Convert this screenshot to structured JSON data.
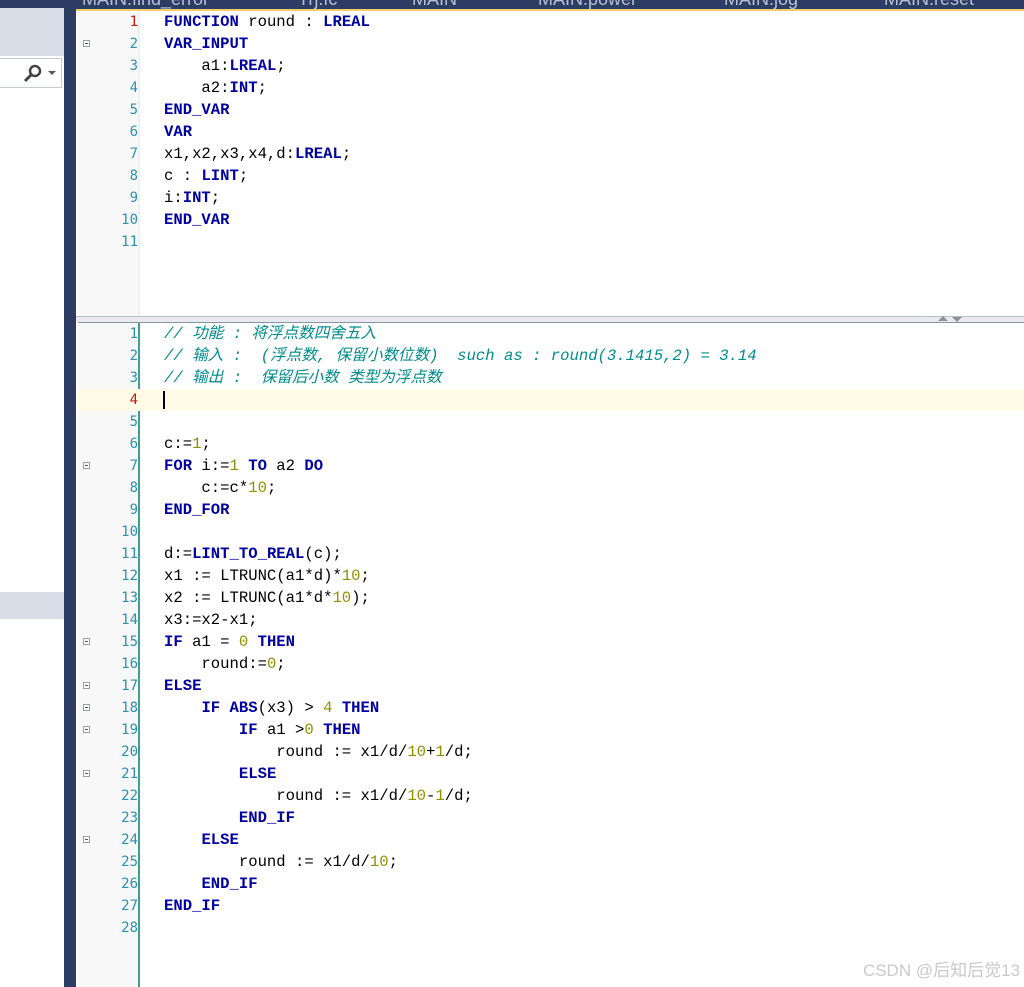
{
  "tabs": [
    "MAIN.find_error",
    "Trj.fc",
    "MAIN",
    "MAIN.power",
    "MAIN.jog",
    "MAIN.reset"
  ],
  "icons": [
    "pin-icon",
    "close-icon",
    "search-icon",
    "dropdown-arrow-icon"
  ],
  "declaration": {
    "current_line": 1,
    "lines": [
      {
        "n": "1",
        "code": "<span class='k'>FUNCTION</span> round : <span class='k'>LREAL</span>"
      },
      {
        "n": "2",
        "fold": true,
        "code": "<span class='k'>VAR_INPUT</span>"
      },
      {
        "n": "3",
        "code": "    a1:<span class='k'>LREAL</span>;"
      },
      {
        "n": "4",
        "code": "    a2:<span class='k'>INT</span>;"
      },
      {
        "n": "5",
        "code": "<span class='k'>END_VAR</span>"
      },
      {
        "n": "6",
        "code": "<span class='k'>VAR</span>"
      },
      {
        "n": "7",
        "code": "x1,x2,x3,x4,d:<span class='k'>LREAL</span>;"
      },
      {
        "n": "8",
        "code": "c : <span class='k'>LINT</span>;"
      },
      {
        "n": "9",
        "code": "i:<span class='k'>INT</span>;"
      },
      {
        "n": "10",
        "code": "<span class='k'>END_VAR</span>"
      },
      {
        "n": "11",
        "code": ""
      }
    ]
  },
  "implementation": {
    "current_line": 4,
    "lines": [
      {
        "n": "1",
        "code": "<span class='c'>// 功能 : 将浮点数四舍五入</span>"
      },
      {
        "n": "2",
        "code": "<span class='c'>// 输入 :  (浮点数, 保留小数位数)  such as : round(3.1415,2) = 3.14</span>"
      },
      {
        "n": "3",
        "code": "<span class='c'>// 输出 :  保留后小数 类型为浮点数</span>"
      },
      {
        "n": "4",
        "code": "",
        "cur": true
      },
      {
        "n": "5",
        "code": ""
      },
      {
        "n": "6",
        "code": "c:=<span class='n'>1</span>;"
      },
      {
        "n": "7",
        "fold": true,
        "code": "<span class='k'>FOR</span> i:=<span class='n'>1</span> <span class='k'>TO</span> a2 <span class='k'>DO</span>"
      },
      {
        "n": "8",
        "code": "    c:=c*<span class='n'>10</span>;"
      },
      {
        "n": "9",
        "code": "<span class='k'>END_FOR</span>"
      },
      {
        "n": "10",
        "code": ""
      },
      {
        "n": "11",
        "code": "d:=<span class='k'>LINT_TO_REAL</span>(c);"
      },
      {
        "n": "12",
        "code": "x1 := LTRUNC(a1*d)*<span class='n'>10</span>;"
      },
      {
        "n": "13",
        "code": "x2 := LTRUNC(a1*d*<span class='n'>10</span>);"
      },
      {
        "n": "14",
        "code": "x3:=x2-x1;"
      },
      {
        "n": "15",
        "fold": true,
        "code": "<span class='k'>IF</span> a1 = <span class='n'>0</span> <span class='k'>THEN</span>"
      },
      {
        "n": "16",
        "code": "    round:=<span class='n'>0</span>;"
      },
      {
        "n": "17",
        "fold": true,
        "code": "<span class='k'>ELSE</span>"
      },
      {
        "n": "18",
        "fold": true,
        "code": "    <span class='k'>IF</span> <span class='k'>ABS</span>(x3) &gt; <span class='n'>4</span> <span class='k'>THEN</span>"
      },
      {
        "n": "19",
        "fold": true,
        "code": "        <span class='k'>IF</span> a1 &gt;<span class='n'>0</span> <span class='k'>THEN</span>"
      },
      {
        "n": "20",
        "code": "            round := x1/d/<span class='n'>10</span>+<span class='n'>1</span>/d;"
      },
      {
        "n": "21",
        "fold": true,
        "code": "        <span class='k'>ELSE</span>"
      },
      {
        "n": "22",
        "code": "            round := x1/d/<span class='n'>10</span>-<span class='n'>1</span>/d;"
      },
      {
        "n": "23",
        "code": "        <span class='k'>END_IF</span>"
      },
      {
        "n": "24",
        "fold": true,
        "code": "    <span class='k'>ELSE</span>"
      },
      {
        "n": "25",
        "code": "        round := x1/d/<span class='n'>10</span>;"
      },
      {
        "n": "26",
        "code": "    <span class='k'>END_IF</span>"
      },
      {
        "n": "27",
        "code": "<span class='k'>END_IF</span>"
      },
      {
        "n": "28",
        "code": ""
      }
    ]
  },
  "watermark": "CSDN @后知后觉13",
  "colors": {
    "keyword": "#0000a0",
    "number": "#8f8f00",
    "comment": "#008b8b",
    "line_number": "#2b91af",
    "current_line_number": "#c41a16",
    "frame": "#2d3c62"
  }
}
